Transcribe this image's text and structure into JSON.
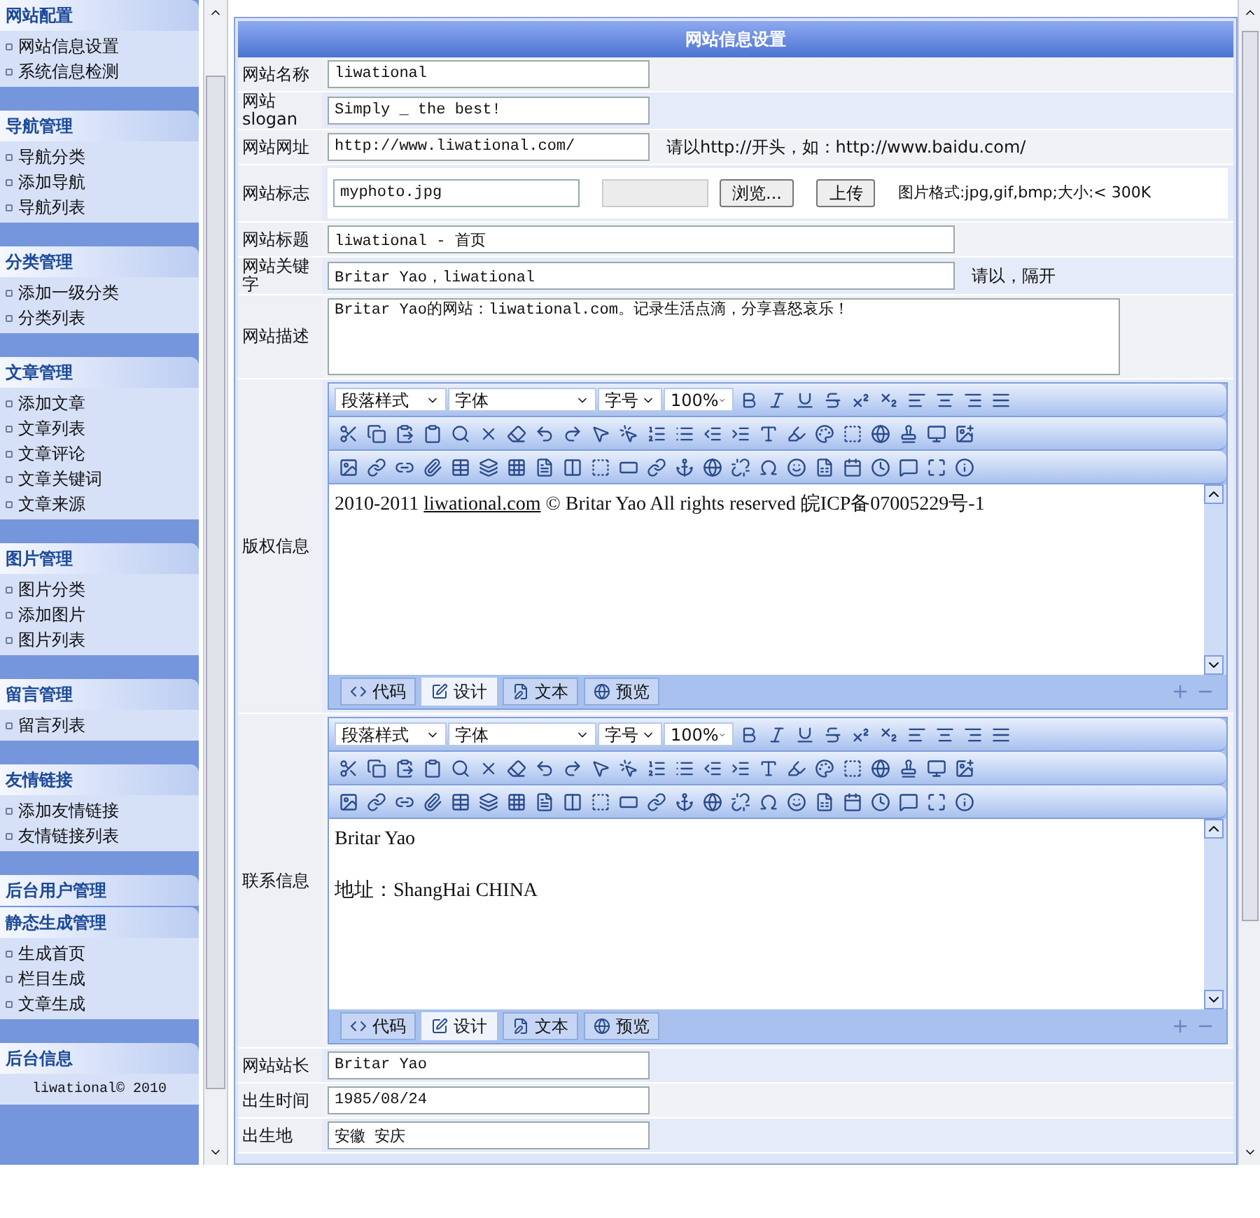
{
  "sidebar": {
    "groups": [
      {
        "title": "网站配置",
        "items": [
          "网站信息设置",
          "系统信息检测"
        ]
      },
      {
        "title": "导航管理",
        "items": [
          "导航分类",
          "添加导航",
          "导航列表"
        ]
      },
      {
        "title": "分类管理",
        "items": [
          "添加一级分类",
          "分类列表"
        ]
      },
      {
        "title": "文章管理",
        "items": [
          "添加文章",
          "文章列表",
          "文章评论",
          "文章关键词",
          "文章来源"
        ]
      },
      {
        "title": "图片管理",
        "items": [
          "图片分类",
          "添加图片",
          "图片列表"
        ]
      },
      {
        "title": "留言管理",
        "items": [
          "留言列表"
        ]
      },
      {
        "title": "友情链接",
        "items": [
          "添加友情链接",
          "友情链接列表"
        ]
      },
      {
        "title": "后台用户管理"
      },
      {
        "title": "静态生成管理",
        "items": [
          "生成首页",
          "栏目生成",
          "文章生成"
        ]
      },
      {
        "title": "后台信息",
        "footer": "liwational© 2010"
      }
    ]
  },
  "panel": {
    "title": "网站信息设置",
    "rows": [
      {
        "kind": "input",
        "label": "网站名称",
        "value": "liwational"
      },
      {
        "kind": "input",
        "label": "网站 slogan",
        "value": "Simply _ the best!"
      },
      {
        "kind": "input",
        "label": "网站网址",
        "value": "http://www.liwational.com/",
        "hint": "请以http://开头，如：http://www.baidu.com/"
      },
      {
        "kind": "file",
        "label": "网站标志",
        "value": "myphoto.jpg",
        "browse": "浏览...",
        "upload": "上传",
        "hint": "图片格式:jpg,gif,bmp;大小:< 300K"
      },
      {
        "kind": "wide_input",
        "label": "网站标题",
        "value": "liwational - 首页"
      },
      {
        "kind": "wide_input",
        "label": "网站关键字",
        "value": "Britar Yao，liwational",
        "hint": "请以，隔开"
      },
      {
        "kind": "textarea",
        "label": "网站描述",
        "value": "Britar Yao的网站：liwational.com。记录生活点滴，分享喜怒哀乐！"
      },
      {
        "kind": "editor",
        "label": "版权信息",
        "selects": [
          "段落样式",
          "字体",
          "字号",
          "100%"
        ],
        "content": [
          {
            "before": "2010-2011 ",
            "link": "liwational.com",
            "after": " © Britar Yao All rights reserved   皖ICP备07005229号-1"
          }
        ],
        "tabs": [
          {
            "label": "代码",
            "selected": false
          },
          {
            "label": "设计",
            "selected": true
          },
          {
            "label": "文本",
            "selected": false
          },
          {
            "label": "预览",
            "selected": false
          }
        ]
      },
      {
        "kind": "editor",
        "label": "联系信息",
        "selects": [
          "段落样式",
          "字体",
          "字号",
          "100%"
        ],
        "content": [
          {
            "before": "Britar Yao"
          },
          {
            "before": "地址：ShangHai CHINA"
          }
        ],
        "tabs": [
          {
            "label": "代码",
            "selected": false
          },
          {
            "label": "设计",
            "selected": true
          },
          {
            "label": "文本",
            "selected": false
          },
          {
            "label": "预览",
            "selected": false
          }
        ]
      },
      {
        "kind": "input",
        "label": "网站站长",
        "value": "Britar Yao"
      },
      {
        "kind": "input",
        "label": "出生时间",
        "value": "1985/08/24"
      },
      {
        "kind": "input",
        "label": "出生地",
        "value": "安徽 安庆"
      }
    ]
  }
}
